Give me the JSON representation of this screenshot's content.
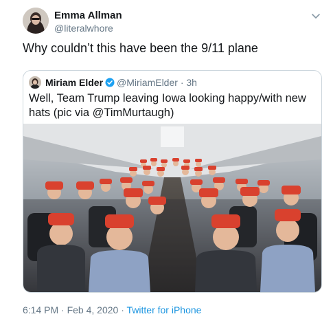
{
  "author": {
    "name": "Emma Allman",
    "handle": "@literalwhore"
  },
  "tweet": {
    "text": "Why couldn’t this have been the 9/11 plane"
  },
  "quoted": {
    "name": "Miriam Elder",
    "handle": "@MiriamElder",
    "dot": "·",
    "time": "3h",
    "text": "Well, Team Trump leaving Iowa looking happy/with new hats (pic via @TimMurtaugh)"
  },
  "footer": {
    "timestamp": "6:14 PM · Feb 4, 2020 ·",
    "source": "Twitter for iPhone"
  },
  "colors": {
    "link": "#1b95e0",
    "muted": "#657786",
    "text": "#14171a",
    "verified": "#1da1f2",
    "hat_red": "#d9412e"
  },
  "icons": {
    "menu": "chevron-down-icon",
    "verified": "verified-badge-icon"
  }
}
